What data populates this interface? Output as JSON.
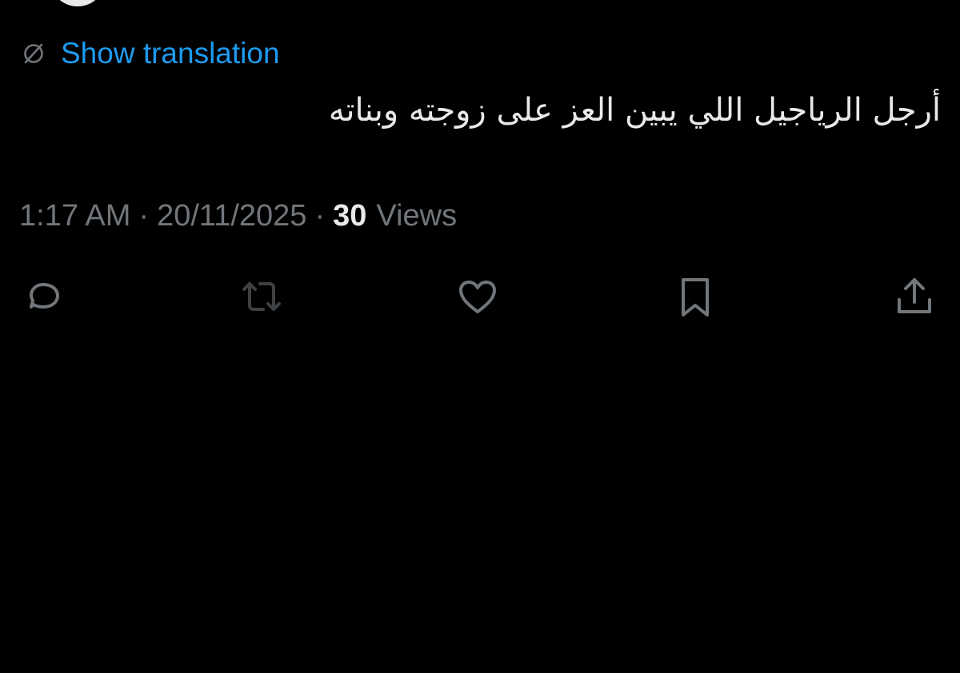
{
  "translation": {
    "link_label": "Show translation",
    "icon": "globe-slash-icon",
    "color": "#1d9bf0"
  },
  "tweet": {
    "text": "أرجل الرياجيل اللي يبين العز على زوجته وبناته",
    "time": "1:17 AM",
    "separator": "·",
    "date": "20/11/2025",
    "views_count": "30",
    "views_label": "Views"
  },
  "actions": [
    {
      "icon": "reply-icon"
    },
    {
      "icon": "retweet-icon"
    },
    {
      "icon": "like-icon"
    },
    {
      "icon": "bookmark-icon"
    },
    {
      "icon": "share-icon"
    }
  ],
  "colors": {
    "background": "#000000",
    "primary_text": "#e7e9ea",
    "secondary_text": "#71767b",
    "icon": "#71767b",
    "accent": "#1d9bf0"
  }
}
